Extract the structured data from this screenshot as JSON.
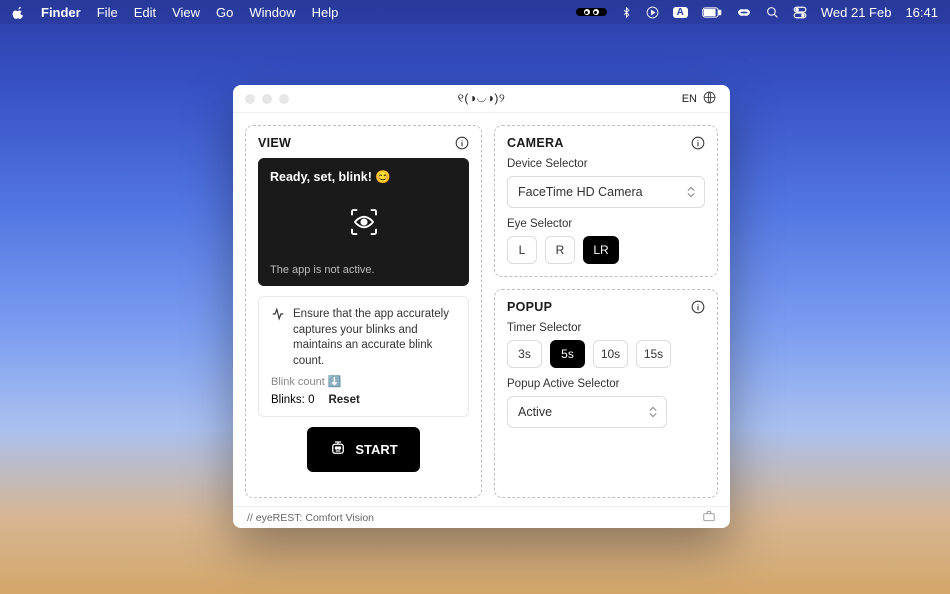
{
  "menubar": {
    "app": "Finder",
    "items": [
      "File",
      "Edit",
      "View",
      "Go",
      "Window",
      "Help"
    ],
    "date": "Wed 21 Feb",
    "time": "16:41",
    "input_badge": "A"
  },
  "window": {
    "title": "୧(◑◡◑)୨",
    "lang": "EN",
    "footer": "// eyeREST: Comfort Vision"
  },
  "view": {
    "title": "VIEW",
    "preview_heading": "Ready, set, blink! 😊",
    "preview_status": "The app is not active.",
    "hint": "Ensure that the app accurately captures your blinks and maintains an accurate blink count.",
    "blink_label": "Blink count ⬇️",
    "blinks_value": "Blinks: 0",
    "reset": "Reset",
    "start": "START"
  },
  "camera": {
    "title": "CAMERA",
    "device_label": "Device Selector",
    "device_value": "FaceTime HD Camera",
    "eye_label": "Eye Selector",
    "eye_options": {
      "l": "L",
      "r": "R",
      "lr": "LR"
    },
    "eye_selected": "LR"
  },
  "popup": {
    "title": "POPUP",
    "timer_label": "Timer Selector",
    "timer_options": {
      "a": "3s",
      "b": "5s",
      "c": "10s",
      "d": "15s"
    },
    "timer_selected": "5s",
    "active_label": "Popup Active Selector",
    "active_value": "Active"
  }
}
